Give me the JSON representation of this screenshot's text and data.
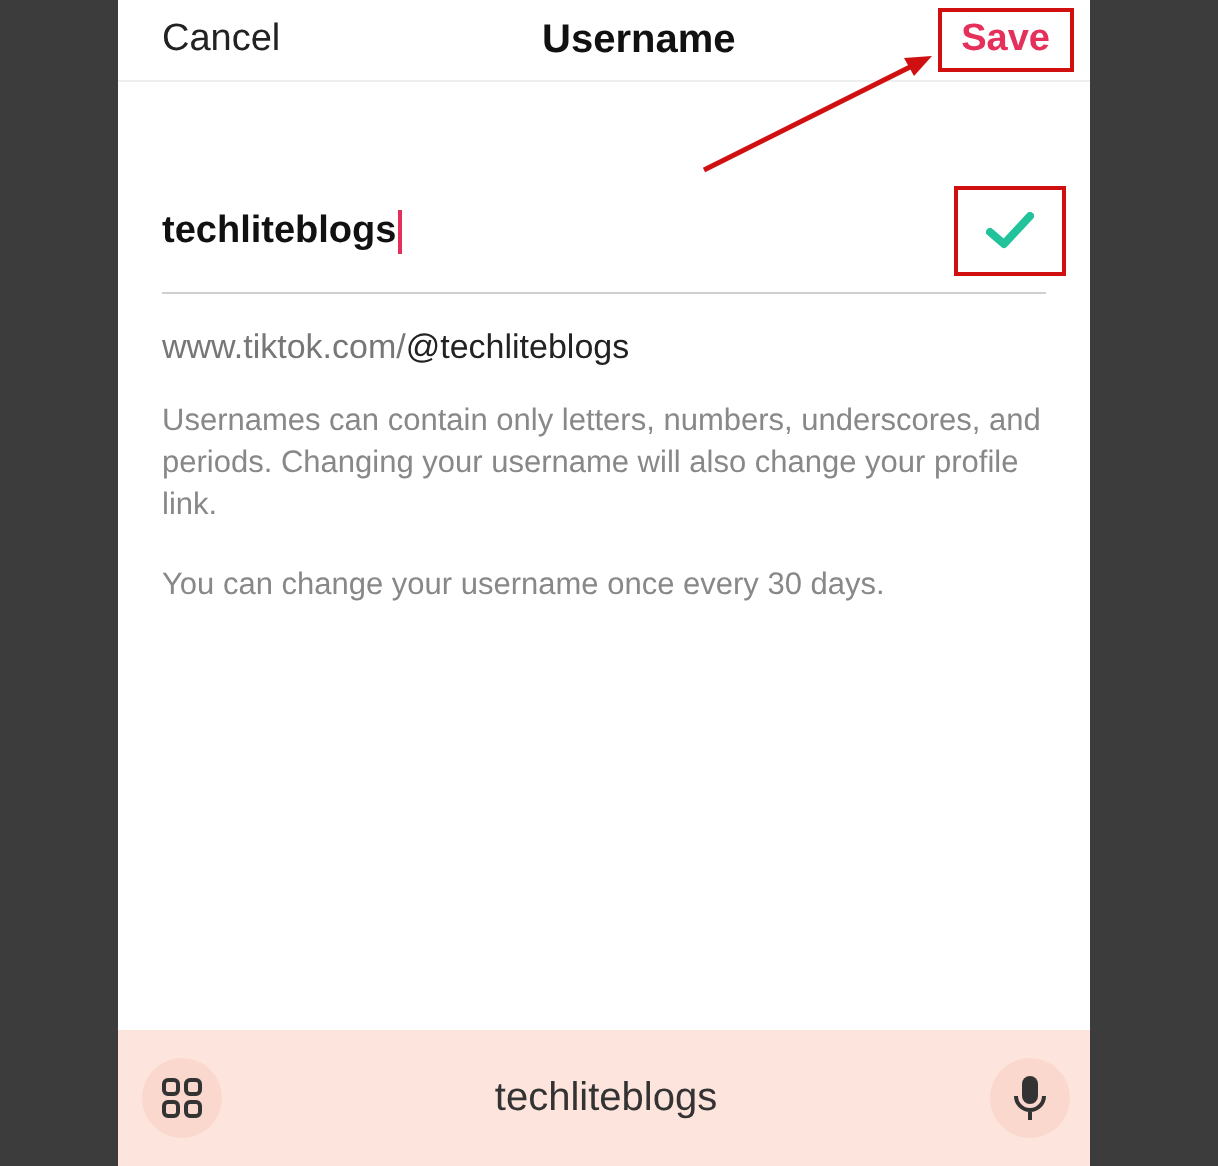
{
  "header": {
    "cancel": "Cancel",
    "title": "Username",
    "save": {
      "label": "Save",
      "highlighted": true
    }
  },
  "field": {
    "value": "techliteblogs",
    "valid": true,
    "check_highlighted": true
  },
  "profile_link": {
    "prefix": "www.tiktok.com/",
    "handle": "@techliteblogs"
  },
  "notes": [
    "Usernames can contain only letters, numbers, underscores, and periods. Changing your username will also change your profile link.",
    "You can change your username once every 30 days."
  ],
  "keyboard_bar": {
    "suggestion": "techliteblogs"
  },
  "annotation": {
    "kind": "arrow"
  }
}
